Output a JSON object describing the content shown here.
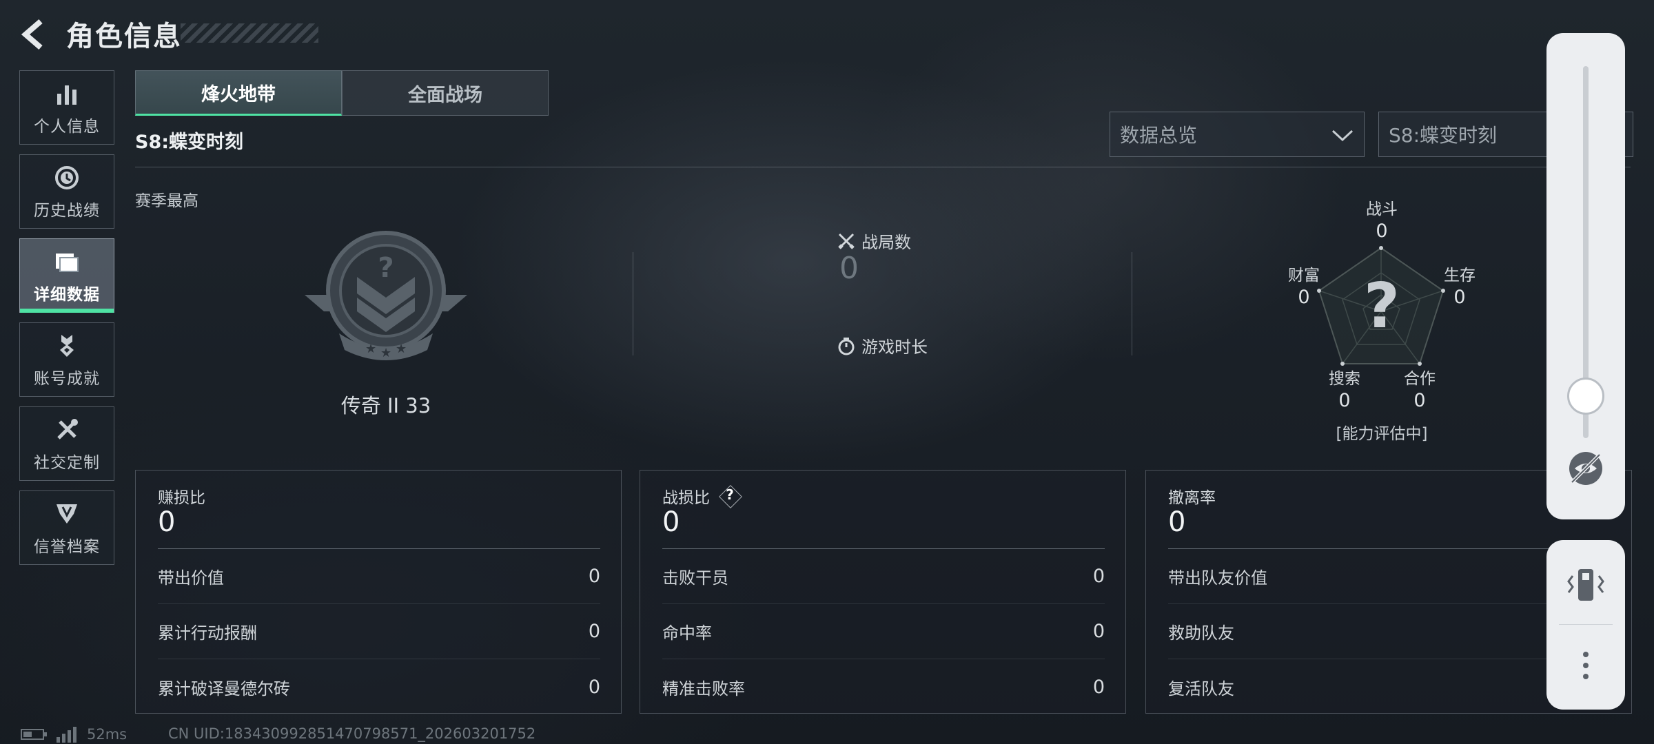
{
  "header": {
    "title": "角色信息"
  },
  "sidebar": {
    "items": [
      {
        "label": "个人信息",
        "icon": "bar-chart-icon"
      },
      {
        "label": "历史战绩",
        "icon": "history-icon"
      },
      {
        "label": "详细数据",
        "icon": "folder-icon",
        "active": true
      },
      {
        "label": "账号成就",
        "icon": "medal-icon"
      },
      {
        "label": "社交定制",
        "icon": "tools-icon"
      },
      {
        "label": "信誉档案",
        "icon": "shield-emblem-icon"
      }
    ]
  },
  "tabs": [
    {
      "label": "烽火地带",
      "active": true
    },
    {
      "label": "全面战场",
      "active": false
    }
  ],
  "season": {
    "title": "S8:蝶变时刻"
  },
  "dropdowns": {
    "data_view": "数据总览",
    "season_select": "S8:蝶变时刻"
  },
  "season_best": {
    "label": "赛季最高",
    "rank": "传奇 II 33"
  },
  "match_stats": {
    "matches_label": "战局数",
    "matches_value": "0",
    "playtime_label": "游戏时长"
  },
  "radar": {
    "center_mark": "?",
    "combat": {
      "label": "战斗",
      "value": "0"
    },
    "survival": {
      "label": "生存",
      "value": "0"
    },
    "cooperation": {
      "label": "合作",
      "value": "0"
    },
    "search": {
      "label": "搜索",
      "value": "0"
    },
    "wealth": {
      "label": "财富",
      "value": "0"
    },
    "assessment": "[能力评估中]"
  },
  "panels": [
    {
      "title": "赚损比",
      "value": "0",
      "help": false,
      "rows": [
        {
          "label": "带出价值",
          "value": "0"
        },
        {
          "label": "累计行动报酬",
          "value": "0"
        },
        {
          "label": "累计破译曼德尔砖",
          "value": "0"
        }
      ]
    },
    {
      "title": "战损比",
      "value": "0",
      "help": true,
      "help_mark": "?",
      "rows": [
        {
          "label": "击败干员",
          "value": "0"
        },
        {
          "label": "命中率",
          "value": "0"
        },
        {
          "label": "精准击败率",
          "value": "0"
        }
      ]
    },
    {
      "title": "撤离率",
      "value": "0",
      "help": false,
      "rows": [
        {
          "label": "带出队友价值",
          "value": ""
        },
        {
          "label": "救助队友",
          "value": ""
        },
        {
          "label": "复活队友",
          "value": ""
        }
      ]
    }
  ],
  "status": {
    "ping": "52ms",
    "uid": "CN UID:18343099285147079857​1_202603201752"
  },
  "colors": {
    "accent": "#4fe3a4",
    "panel_border": "#8a96a0",
    "floating_bg": "#eceef1"
  }
}
